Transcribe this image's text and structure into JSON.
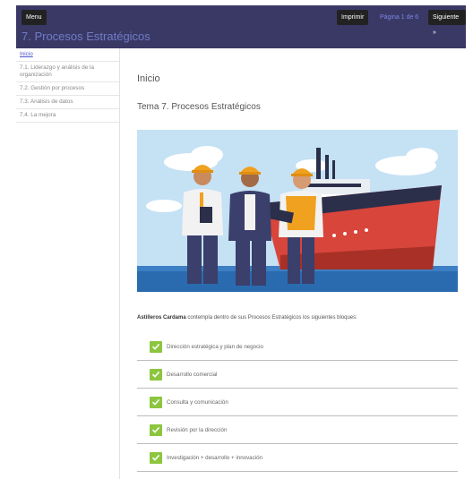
{
  "topbar": {
    "menu_label": "Menu",
    "print_label": "Imprimir",
    "page_info": "Página 1 de 6",
    "next_label": "Siguiente »",
    "chapter_title": "7. Procesos Estratégicos"
  },
  "sidebar": {
    "items": [
      {
        "label": "Inicio"
      },
      {
        "label": "7.1. Liderazgo y análisis de la organización"
      },
      {
        "label": "7.2. Gestión por procesos"
      },
      {
        "label": "7.3. Análisis de datos"
      },
      {
        "label": "7.4. La mejora"
      }
    ]
  },
  "main": {
    "heading": "Inicio",
    "topic": "Tema 7. Procesos Estratégicos",
    "intro_company": "Astilleros Cardama",
    "intro_text": " contempla dentro de sus Procesos Estratégicos los siguientes bloques:",
    "blocks": [
      {
        "label": "Dirección estratégica y plan de negocio"
      },
      {
        "label": "Desarrollo comercial"
      },
      {
        "label": "Consulta y comunicación"
      },
      {
        "label": "Revisión por la dirección"
      },
      {
        "label": "Investigación + desarrollo + innovación"
      }
    ]
  },
  "colors": {
    "topbar": "#3a3966",
    "accent": "#6e7cc6",
    "check": "#8cc63f",
    "sky": "#c5e1f4",
    "sea": "#2a6bb0",
    "hull_red": "#d8453b"
  }
}
